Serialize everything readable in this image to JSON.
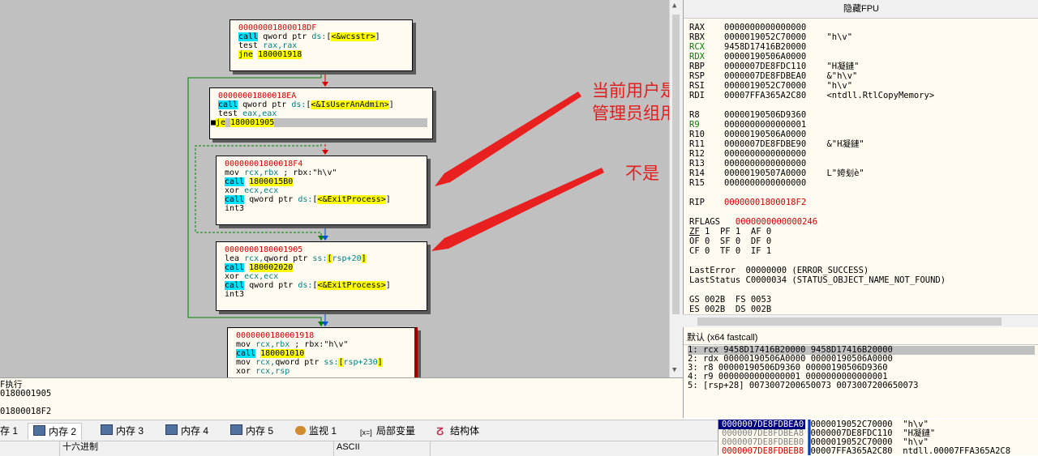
{
  "graph": {
    "blocks": [
      {
        "addr": "00000001800018DF",
        "lines": [
          {
            "parts": [
              {
                "t": "call",
                "c": "call-hl"
              },
              {
                "t": " qword ptr ",
                "c": "plain"
              },
              {
                "t": "ds:",
                "c": "seg"
              },
              {
                "t": "[",
                "c": "plain"
              },
              {
                "t": "<&wcsstr>",
                "c": "yel-hl"
              },
              {
                "t": "]",
                "c": "plain"
              }
            ]
          },
          {
            "parts": [
              {
                "t": "test ",
                "c": "plain"
              },
              {
                "t": "rax,rax",
                "c": "reg"
              }
            ]
          },
          {
            "parts": [
              {
                "t": "jne",
                "c": "jmp-hl"
              },
              {
                "t": " ",
                "c": "plain"
              },
              {
                "t": "180001918",
                "c": "yel-hl"
              }
            ]
          }
        ]
      },
      {
        "addr": "00000001800018EA",
        "lines": [
          {
            "parts": [
              {
                "t": "call",
                "c": "call-hl"
              },
              {
                "t": " qword ptr ",
                "c": "plain"
              },
              {
                "t": "ds:",
                "c": "seg"
              },
              {
                "t": "[",
                "c": "plain"
              },
              {
                "t": "<&IsUserAnAdmin>",
                "c": "yel-hl"
              },
              {
                "t": "]",
                "c": "plain"
              }
            ]
          },
          {
            "parts": [
              {
                "t": "test ",
                "c": "plain"
              },
              {
                "t": "eax,eax",
                "c": "reg"
              }
            ]
          },
          {
            "cur": true,
            "parts": [
              {
                "t": "je",
                "c": "jmp-hl"
              },
              {
                "t": " ",
                "c": "plain"
              },
              {
                "t": "180001905",
                "c": "yel-hl"
              }
            ]
          }
        ]
      },
      {
        "addr": "00000001800018F4",
        "lines": [
          {
            "parts": [
              {
                "t": "mov ",
                "c": "plain"
              },
              {
                "t": "rcx,rbx",
                "c": "reg"
              },
              {
                "t": " ; rbx:\"h\\v\"",
                "c": "plain"
              }
            ]
          },
          {
            "parts": [
              {
                "t": "call",
                "c": "call-hl"
              },
              {
                "t": " ",
                "c": "plain"
              },
              {
                "t": "1800015B0",
                "c": "yel-hl"
              }
            ]
          },
          {
            "parts": [
              {
                "t": "xor ",
                "c": "plain"
              },
              {
                "t": "ecx,ecx",
                "c": "reg"
              }
            ]
          },
          {
            "parts": [
              {
                "t": "call",
                "c": "call-hl"
              },
              {
                "t": " qword ptr ",
                "c": "plain"
              },
              {
                "t": "ds:",
                "c": "seg"
              },
              {
                "t": "[",
                "c": "plain"
              },
              {
                "t": "<&ExitProcess>",
                "c": "yel-hl"
              },
              {
                "t": "]",
                "c": "plain"
              }
            ]
          },
          {
            "parts": [
              {
                "t": "int3",
                "c": "plain"
              }
            ]
          }
        ]
      },
      {
        "addr": "0000000180001905",
        "lines": [
          {
            "parts": [
              {
                "t": "lea ",
                "c": "plain"
              },
              {
                "t": "rcx,",
                "c": "reg"
              },
              {
                "t": "qword ptr ",
                "c": "plain"
              },
              {
                "t": "ss:",
                "c": "seg"
              },
              {
                "t": "[",
                "c": "yel-hl"
              },
              {
                "t": "rsp+20",
                "c": "reg"
              },
              {
                "t": "]",
                "c": "yel-hl"
              }
            ]
          },
          {
            "parts": [
              {
                "t": "call",
                "c": "call-hl"
              },
              {
                "t": " ",
                "c": "plain"
              },
              {
                "t": "180002020",
                "c": "yel-hl"
              }
            ]
          },
          {
            "parts": [
              {
                "t": "xor ",
                "c": "plain"
              },
              {
                "t": "ecx,ecx",
                "c": "reg"
              }
            ]
          },
          {
            "parts": [
              {
                "t": "call",
                "c": "call-hl"
              },
              {
                "t": " qword ptr ",
                "c": "plain"
              },
              {
                "t": "ds:",
                "c": "seg"
              },
              {
                "t": "[",
                "c": "plain"
              },
              {
                "t": "<&ExitProcess>",
                "c": "yel-hl"
              },
              {
                "t": "]",
                "c": "plain"
              }
            ]
          },
          {
            "parts": [
              {
                "t": "int3",
                "c": "plain"
              }
            ]
          }
        ]
      },
      {
        "addr": "0000000180001918",
        "lines": [
          {
            "parts": [
              {
                "t": "mov ",
                "c": "plain"
              },
              {
                "t": "rcx,rbx",
                "c": "reg"
              },
              {
                "t": " ; rbx:\"h\\v\"",
                "c": "plain"
              }
            ]
          },
          {
            "parts": [
              {
                "t": "call",
                "c": "call-hl"
              },
              {
                "t": " ",
                "c": "plain"
              },
              {
                "t": "180001010",
                "c": "yel-hl"
              }
            ]
          },
          {
            "parts": [
              {
                "t": "mov ",
                "c": "plain"
              },
              {
                "t": "rcx,",
                "c": "reg"
              },
              {
                "t": "qword ptr ",
                "c": "plain"
              },
              {
                "t": "ss:",
                "c": "seg"
              },
              {
                "t": "[",
                "c": "yel-hl"
              },
              {
                "t": "rsp+230",
                "c": "reg"
              },
              {
                "t": "]",
                "c": "yel-hl"
              }
            ]
          },
          {
            "parts": [
              {
                "t": "xor ",
                "c": "plain"
              },
              {
                "t": "rcx,rsp",
                "c": "reg"
              }
            ]
          }
        ]
      }
    ],
    "annotations": {
      "admin_note": "当前用户是\n管理员组用户",
      "not_note": "不是"
    }
  },
  "registers": {
    "header": "隐藏FPU",
    "gp": [
      {
        "name": "RAX",
        "value": "0000000000000000",
        "comment": "",
        "color": "black"
      },
      {
        "name": "RBX",
        "value": "0000019052C70000",
        "comment": "\"h\\v\"",
        "color": "black"
      },
      {
        "name": "RCX",
        "value": "9458D17416B20000",
        "comment": "",
        "color": "green"
      },
      {
        "name": "RDX",
        "value": "00000190506A0000",
        "comment": "",
        "color": "green"
      },
      {
        "name": "RBP",
        "value": "0000007DE8FDC110",
        "comment": "\"H凝鏈\"",
        "color": "black"
      },
      {
        "name": "RSP",
        "value": "0000007DE8FDBEA0",
        "comment": "&\"h\\v\"",
        "color": "black"
      },
      {
        "name": "RSI",
        "value": "0000019052C70000",
        "comment": "\"h\\v\"",
        "color": "black"
      },
      {
        "name": "RDI",
        "value": "00007FFA365A2C80",
        "comment": "<ntdll.RtlCopyMemory>",
        "color": "black"
      },
      {
        "name": "R8",
        "value": "00000190506D9360",
        "comment": "",
        "color": "black"
      },
      {
        "name": "R9",
        "value": "0000000000000001",
        "comment": "",
        "color": "green"
      },
      {
        "name": "R10",
        "value": "00000190506A0000",
        "comment": "",
        "color": "black"
      },
      {
        "name": "R11",
        "value": "0000007DE8FDBE90",
        "comment": "&\"H凝鏈\"",
        "color": "black"
      },
      {
        "name": "R12",
        "value": "0000000000000000",
        "comment": "",
        "color": "black"
      },
      {
        "name": "R13",
        "value": "0000000000000000",
        "comment": "",
        "color": "black"
      },
      {
        "name": "R14",
        "value": "00000190507A0000",
        "comment": "L\"姱刬è\"",
        "color": "black"
      },
      {
        "name": "R15",
        "value": "0000000000000000",
        "comment": "",
        "color": "black"
      }
    ],
    "rip_name": "RIP",
    "rip_value": "00000001800018F2",
    "rflags_name": "RFLAGS",
    "rflags_value": "0000000000000246",
    "flags_line1_zf": "ZF",
    "flags_line1_rest": " 1  PF 1  AF 0",
    "flags_line2": "OF 0  SF 0  DF 0",
    "flags_line3": "CF 0  TF 0  IF 1",
    "last_error": "LastError  00000000 (ERROR_SUCCESS)",
    "last_status": "LastStatus C0000034 (STATUS_OBJECT_NAME_NOT_FOUND)",
    "seg1": "GS 002B  FS 0053",
    "seg2": "ES 002B  DS 002B"
  },
  "callargs": {
    "header": "默认 (x64 fastcall)",
    "rows": [
      "1: rcx 9458D17416B20000 9458D17416B20000",
      "2: rdx 00000190506A0000 00000190506A0000",
      "3: r8 00000190506D9360 00000190506D9360",
      "4: r9 0000000000000001 0000000000000001",
      "5: [rsp+28] 0073007200650073 0073007200650073"
    ]
  },
  "log": {
    "lines": [
      "F执行",
      "0180001905",
      "",
      "01800018F2"
    ]
  },
  "tabs": [
    {
      "label": "存 1",
      "icon": "none"
    },
    {
      "label": "内存 2",
      "icon": "mem",
      "active": true
    },
    {
      "label": "内存 3",
      "icon": "mem"
    },
    {
      "label": "内存 4",
      "icon": "mem"
    },
    {
      "label": "内存 5",
      "icon": "mem"
    },
    {
      "label": "监视 1",
      "icon": "watch"
    },
    {
      "label": "局部变量",
      "icon": "locals"
    },
    {
      "label": "结构体",
      "icon": "struct"
    }
  ],
  "dump": {
    "col_hex": "十六进制",
    "col_ascii": "ASCII"
  },
  "stack": {
    "rows": [
      {
        "addr": "0000007DE8FDBEA0",
        "val": "0000019052C70000",
        "cmt": "\"h\\v\"",
        "style": "sel"
      },
      {
        "addr": "0000007DE8FDBEA8",
        "val": "0000007DE8FDC110",
        "cmt": "\"H凝鏈\"",
        "style": "gray"
      },
      {
        "addr": "0000007DE8FDBEB0",
        "val": "0000019052C70000",
        "cmt": "\"h\\v\"",
        "style": "gray"
      },
      {
        "addr": "0000007DE8FDBEB8",
        "val": "00007FFA365A2C80",
        "cmt": "ntdll.00007FFA365A2C8",
        "style": "red"
      }
    ]
  }
}
